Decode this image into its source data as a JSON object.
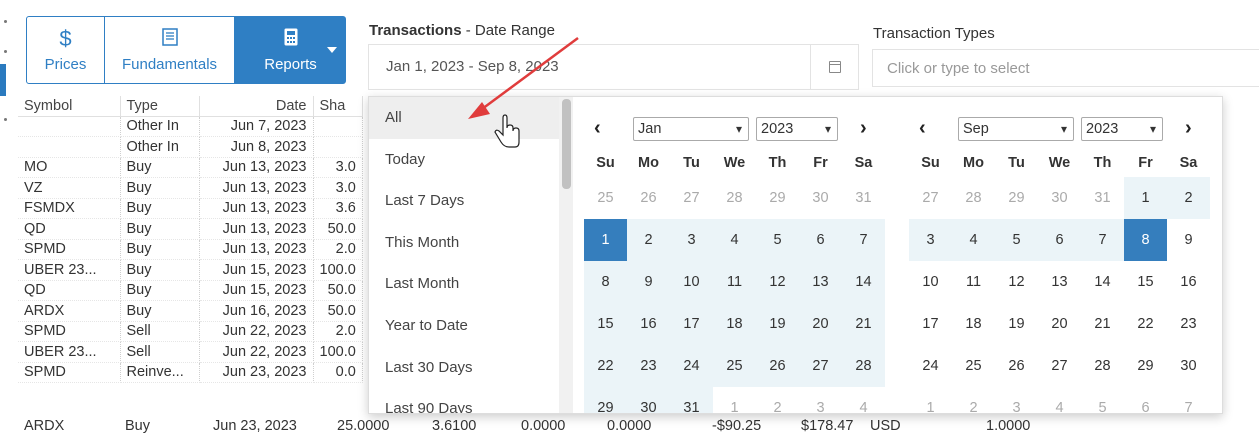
{
  "toolbar": {
    "prices_label": "Prices",
    "fundamentals_label": "Fundamentals",
    "reports_label": "Reports"
  },
  "transactions": {
    "title_bold": "Transactions",
    "title_rest": " - Date Range",
    "date_range_value": "Jan 1, 2023 - Sep 8, 2023"
  },
  "transaction_types": {
    "label": "Transaction Types",
    "placeholder": "Click or type to select"
  },
  "table": {
    "headers": {
      "symbol": "Symbol",
      "type": "Type",
      "date": "Date",
      "shares": "Sha"
    },
    "rows": [
      {
        "symbol": "",
        "type": "Other In",
        "date": "Jun 7, 2023",
        "shares": ""
      },
      {
        "symbol": "",
        "type": "Other In",
        "date": "Jun 8, 2023",
        "shares": ""
      },
      {
        "symbol": "MO",
        "type": "Buy",
        "date": "Jun 13, 2023",
        "shares": "3.0"
      },
      {
        "symbol": "VZ",
        "type": "Buy",
        "date": "Jun 13, 2023",
        "shares": "3.0"
      },
      {
        "symbol": "FSMDX",
        "type": "Buy",
        "date": "Jun 13, 2023",
        "shares": "3.6"
      },
      {
        "symbol": "QD",
        "type": "Buy",
        "date": "Jun 13, 2023",
        "shares": "50.0"
      },
      {
        "symbol": "SPMD",
        "type": "Buy",
        "date": "Jun 13, 2023",
        "shares": "2.0"
      },
      {
        "symbol": "UBER 23...",
        "type": "Buy",
        "date": "Jun 15, 2023",
        "shares": "100.0"
      },
      {
        "symbol": "QD",
        "type": "Buy",
        "date": "Jun 15, 2023",
        "shares": "50.0"
      },
      {
        "symbol": "ARDX",
        "type": "Buy",
        "date": "Jun 16, 2023",
        "shares": "50.0"
      },
      {
        "symbol": "SPMD",
        "type": "Sell",
        "date": "Jun 22, 2023",
        "shares": "2.0"
      },
      {
        "symbol": "UBER 23...",
        "type": "Sell",
        "date": "Jun 22, 2023",
        "shares": "100.0"
      },
      {
        "symbol": "SPMD",
        "type": "Reinve...",
        "date": "Jun 23, 2023",
        "shares": "0.0"
      }
    ],
    "last_row": {
      "symbol": "ARDX",
      "type": "Buy",
      "date": "Jun 23, 2023",
      "shares": "25.0000",
      "price": "3.6100",
      "c1": "0.0000",
      "c2": "0.0000",
      "amount": "-$90.25",
      "value": "$178.47",
      "currency": "USD",
      "rate": "1.0000"
    }
  },
  "picker": {
    "ranges": [
      "All",
      "Today",
      "Last 7 Days",
      "This Month",
      "Last Month",
      "Year to Date",
      "Last 30 Days",
      "Last 90 Days"
    ],
    "active_range": "All",
    "dow": [
      "Su",
      "Mo",
      "Tu",
      "We",
      "Th",
      "Fr",
      "Sa"
    ],
    "left": {
      "month": "Jan",
      "year": "2023",
      "weeks": [
        [
          [
            "25",
            "off"
          ],
          [
            "26",
            "off"
          ],
          [
            "27",
            "off"
          ],
          [
            "28",
            "off"
          ],
          [
            "29",
            "off"
          ],
          [
            "30",
            "off"
          ],
          [
            "31",
            "off"
          ]
        ],
        [
          [
            "1",
            "start"
          ],
          [
            "2",
            "in"
          ],
          [
            "3",
            "in"
          ],
          [
            "4",
            "in"
          ],
          [
            "5",
            "in"
          ],
          [
            "6",
            "in"
          ],
          [
            "7",
            "in"
          ]
        ],
        [
          [
            "8",
            "in"
          ],
          [
            "9",
            "in"
          ],
          [
            "10",
            "in"
          ],
          [
            "11",
            "in"
          ],
          [
            "12",
            "in"
          ],
          [
            "13",
            "in"
          ],
          [
            "14",
            "in"
          ]
        ],
        [
          [
            "15",
            "in"
          ],
          [
            "16",
            "in"
          ],
          [
            "17",
            "in"
          ],
          [
            "18",
            "in"
          ],
          [
            "19",
            "in"
          ],
          [
            "20",
            "in"
          ],
          [
            "21",
            "in"
          ]
        ],
        [
          [
            "22",
            "in"
          ],
          [
            "23",
            "in"
          ],
          [
            "24",
            "in"
          ],
          [
            "25",
            "in"
          ],
          [
            "26",
            "in"
          ],
          [
            "27",
            "in"
          ],
          [
            "28",
            "in"
          ]
        ],
        [
          [
            "29",
            "in"
          ],
          [
            "30",
            "in"
          ],
          [
            "31",
            "in"
          ],
          [
            "1",
            "off"
          ],
          [
            "2",
            "off"
          ],
          [
            "3",
            "off"
          ],
          [
            "4",
            "off"
          ]
        ]
      ]
    },
    "right": {
      "month": "Sep",
      "year": "2023",
      "weeks": [
        [
          [
            "27",
            "off"
          ],
          [
            "28",
            "off"
          ],
          [
            "29",
            "off"
          ],
          [
            "30",
            "off"
          ],
          [
            "31",
            "off"
          ],
          [
            "1",
            "in"
          ],
          [
            "2",
            "in"
          ]
        ],
        [
          [
            "3",
            "in"
          ],
          [
            "4",
            "in"
          ],
          [
            "5",
            "in"
          ],
          [
            "6",
            "in"
          ],
          [
            "7",
            "in"
          ],
          [
            "8",
            "end"
          ],
          [
            "9",
            ""
          ]
        ],
        [
          [
            "10",
            ""
          ],
          [
            "11",
            ""
          ],
          [
            "12",
            ""
          ],
          [
            "13",
            ""
          ],
          [
            "14",
            ""
          ],
          [
            "15",
            ""
          ],
          [
            "16",
            ""
          ]
        ],
        [
          [
            "17",
            ""
          ],
          [
            "18",
            ""
          ],
          [
            "19",
            ""
          ],
          [
            "20",
            ""
          ],
          [
            "21",
            ""
          ],
          [
            "22",
            ""
          ],
          [
            "23",
            ""
          ]
        ],
        [
          [
            "24",
            ""
          ],
          [
            "25",
            ""
          ],
          [
            "26",
            ""
          ],
          [
            "27",
            ""
          ],
          [
            "28",
            ""
          ],
          [
            "29",
            ""
          ],
          [
            "30",
            ""
          ]
        ],
        [
          [
            "1",
            "off"
          ],
          [
            "2",
            "off"
          ],
          [
            "3",
            "off"
          ],
          [
            "4",
            "off"
          ],
          [
            "5",
            "off"
          ],
          [
            "6",
            "off"
          ],
          [
            "7",
            "off"
          ]
        ]
      ]
    }
  },
  "icons": {
    "prices": "dollar-icon",
    "fundamentals": "document-icon",
    "reports": "calculator-icon",
    "calendar": "calendar-icon"
  },
  "colors": {
    "accent": "#2f7fc4",
    "range_highlight": "#ebf4f8",
    "selected_day": "#357ebd",
    "annotation_arrow": "#e03c3c"
  }
}
